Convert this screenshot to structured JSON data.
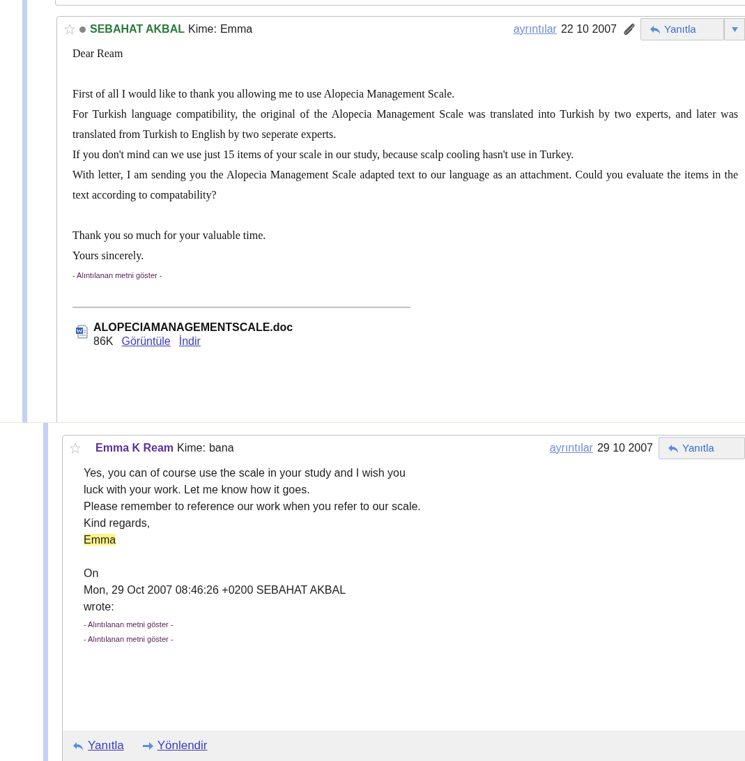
{
  "messages": [
    {
      "kind": "html",
      "starred": false,
      "presence": true,
      "sender": "SEBAHAT AKBAL",
      "color": "#2a7a3a",
      "to_label": "Kime:",
      "to": "Emma",
      "details": "ayrıntılar",
      "date": "22 10 2007",
      "has_attachment": true,
      "reply": "Yanıtla",
      "has_menu": true,
      "body": [
        [
          "Dear Ream"
        ],
        [
          "First of all I would like to thank you allowing me to use Alopecia Management Scale.",
          "For Turkish language compatibility, the original of the Alopecia Management Scale was translated into Turkish by two experts, and later was translated from Turkish to English by two seperate experts.",
          "If you don't mind can we use just 15 items of your scale in our study, because scalp cooling hasn't use in Turkey.",
          "With letter, I am sending you the Alopecia Management Scale adapted text to our language as an attachment. Could you evaluate the items in the text according to compatability?"
        ],
        [
          "Thank you so much for your valuable time.",
          "Yours sincerely."
        ]
      ],
      "quoted": [
        "- Alıntılanan metni göster -"
      ],
      "attachment": {
        "name": "ALOPECIAMANAGEMENTSCALE.doc",
        "size": "86K",
        "links": [
          "Görüntüle",
          "İndir"
        ]
      }
    },
    {
      "kind": "plain",
      "starred": false,
      "presence": false,
      "sender": "Emma K Ream",
      "color": "#5b2e9e",
      "to_label": "Kime:",
      "to": "bana",
      "details": "ayrıntılar",
      "date": "29 10 2007",
      "has_attachment": false,
      "reply": "Yanıtla",
      "has_menu": false,
      "body": [
        [
          {
            "text": "Yes, you can of course use the scale in your study and I wish you",
            "highlighted": false
          },
          {
            "text": "luck with your work.  Let me know how it goes.",
            "highlighted": false
          },
          {
            "text": "Please remember to reference our work when you refer to our scale.",
            "highlighted": false
          },
          {
            "text": "Kind regards,",
            "highlighted": false
          },
          {
            "text": "Emma",
            "highlighted": true
          }
        ],
        [
          {
            "text": "On",
            "highlighted": false
          },
          {
            "text": "Mon, 29 Oct 2007 08:46:26 +0200 SEBAHAT AKBAL",
            "highlighted": false
          },
          {
            "text": "wrote:",
            "highlighted": false
          }
        ]
      ],
      "quoted": [
        "- Alıntılanan metni göster -",
        "- Alıntılanan metni göster -"
      ],
      "footer": [
        "Yanıtla",
        "Yönlendir"
      ]
    }
  ]
}
